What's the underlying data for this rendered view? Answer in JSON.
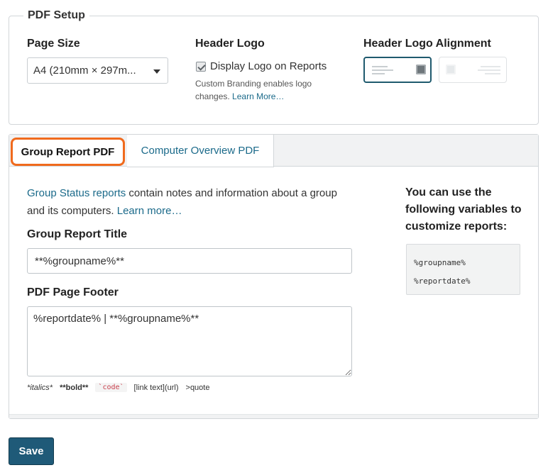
{
  "setup": {
    "legend": "PDF Setup",
    "page_size": {
      "label": "Page Size",
      "selected": "A4 (210mm × 297m..."
    },
    "header_logo": {
      "label": "Header Logo",
      "checkbox_label": "Display Logo on Reports",
      "checked": true,
      "help_text": "Custom Branding enables logo changes.",
      "learn_more": "Learn More…"
    },
    "alignment": {
      "label": "Header Logo Alignment",
      "selected": "left"
    }
  },
  "tabs": [
    {
      "label": "Group Report PDF",
      "active": true
    },
    {
      "label": "Computer Overview PDF",
      "active": false
    }
  ],
  "group_report": {
    "intro_link": "Group Status reports",
    "intro_text": " contain notes and information about a group and its computers. ",
    "learn_more": "Learn more…",
    "title_label": "Group Report Title",
    "title_value": "**%groupname%**",
    "footer_label": "PDF Page Footer",
    "footer_value": "%reportdate% | **%groupname%**",
    "markdown_hints": {
      "italics": "*italics*",
      "bold": "**bold**",
      "code": "`code`",
      "link": "[link text](url)",
      "quote": ">quote"
    }
  },
  "variables": {
    "heading": "You can use the following variables to customize reports:",
    "items": [
      "%groupname%",
      "%reportdate%"
    ]
  },
  "save_label": "Save",
  "colors": {
    "accent": "#1f5a78",
    "link": "#1b6a8a",
    "active_tab_outline": "#f06a1d"
  }
}
